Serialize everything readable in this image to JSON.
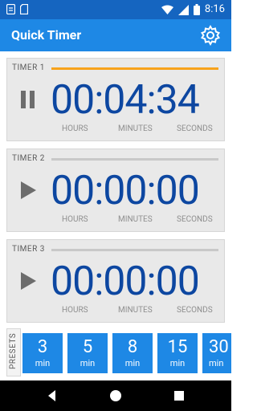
{
  "status_bar": {
    "time": "8:16",
    "icons": [
      "notification-icon",
      "sd-card-icon",
      "wifi-icon",
      "signal-icon",
      "battery-icon"
    ]
  },
  "app_bar": {
    "title": "Quick Timer",
    "settings_icon": "gear-icon"
  },
  "timers": [
    {
      "label": "TIMER 1",
      "time": "00:04:34",
      "hours_label": "HOURS",
      "minutes_label": "MINUTES",
      "seconds_label": "SECONDS",
      "state": "running",
      "control_icon": "pause-icon",
      "progress": 1.0,
      "progress_color": "#f7a21b"
    },
    {
      "label": "TIMER 2",
      "time": "00:00:00",
      "hours_label": "HOURS",
      "minutes_label": "MINUTES",
      "seconds_label": "SECONDS",
      "state": "stopped",
      "control_icon": "play-icon",
      "progress": 0.0
    },
    {
      "label": "TIMER 3",
      "time": "00:00:00",
      "hours_label": "HOURS",
      "minutes_label": "MINUTES",
      "seconds_label": "SECONDS",
      "state": "stopped",
      "control_icon": "play-icon",
      "progress": 0.0
    }
  ],
  "presets": {
    "label": "PRESETS",
    "items": [
      {
        "value": "3",
        "unit": "min"
      },
      {
        "value": "5",
        "unit": "min"
      },
      {
        "value": "8",
        "unit": "min"
      },
      {
        "value": "15",
        "unit": "min"
      },
      {
        "value": "30",
        "unit": "min"
      }
    ]
  },
  "nav_bar": {
    "icons": [
      "back-icon",
      "home-icon",
      "recents-icon"
    ]
  },
  "colors": {
    "status_bar": "#1565c0",
    "app_bar": "#1e88e5",
    "digits": "#0d47a1",
    "preset_button": "#1e88e5",
    "card_background": "#e9e9e9",
    "progress_active": "#f7a21b"
  }
}
